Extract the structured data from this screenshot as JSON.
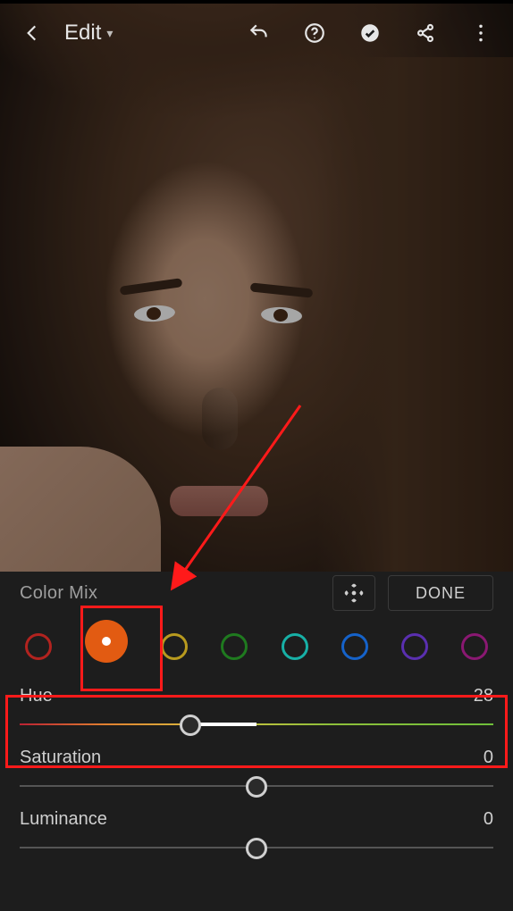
{
  "header": {
    "title": "Edit",
    "icons": {
      "back": "arrow-left-icon",
      "undo": "undo-icon",
      "help": "help-circle-icon",
      "confirm": "check-circle-icon",
      "share": "share-icon",
      "overflow": "overflow-icon"
    }
  },
  "panel": {
    "title": "Color Mix",
    "done_label": "DONE",
    "move_icon": "move-icon"
  },
  "colors": {
    "swatches": [
      {
        "name": "red",
        "hex": "#b2231f",
        "selected": false
      },
      {
        "name": "orange",
        "hex": "#e25b12",
        "selected": true
      },
      {
        "name": "yellow",
        "hex": "#b89a1e",
        "selected": false
      },
      {
        "name": "green",
        "hex": "#1f7a1f",
        "selected": false
      },
      {
        "name": "aqua",
        "hex": "#17b0a6",
        "selected": false
      },
      {
        "name": "blue",
        "hex": "#1562c9",
        "selected": false
      },
      {
        "name": "purple",
        "hex": "#5a2fb0",
        "selected": false
      },
      {
        "name": "magenta",
        "hex": "#8a1872",
        "selected": false
      }
    ]
  },
  "sliders": {
    "hue": {
      "label": "Hue",
      "value": -28,
      "min": -100,
      "max": 100
    },
    "saturation": {
      "label": "Saturation",
      "value": 0,
      "min": -100,
      "max": 100
    },
    "luminance": {
      "label": "Luminance",
      "value": 0,
      "min": -100,
      "max": 100
    }
  },
  "annotations": {
    "arrow_color": "#ff1a1a",
    "highlight_color": "#ff1a1a"
  }
}
